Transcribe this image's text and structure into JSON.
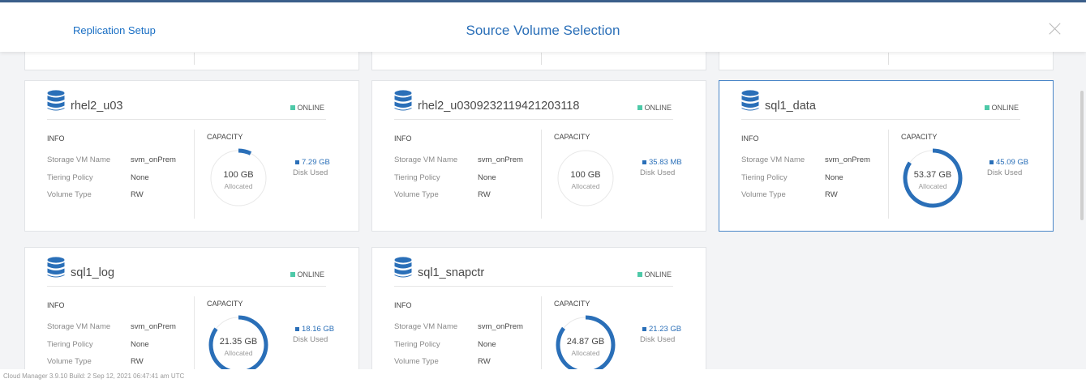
{
  "header": {
    "breadcrumb": "Replication Setup",
    "title": "Source Volume Selection"
  },
  "labels": {
    "info": "INFO",
    "capacity": "CAPACITY",
    "storage_vm": "Storage VM Name",
    "tiering": "Tiering Policy",
    "volume_type": "Volume Type",
    "allocated": "Allocated",
    "disk_used": "Disk Used"
  },
  "colors": {
    "accent": "#2a6fb8",
    "online": "#4ec9a8",
    "selected_border": "#4a86c8"
  },
  "volumes": [
    {
      "name": "rhel2_u03",
      "status": "ONLINE",
      "storage_vm": "svm_onPrem",
      "tiering": "None",
      "volume_type": "RW",
      "allocated": "100 GB",
      "disk_used": "7.29 GB",
      "used_fraction": 0.073,
      "selected": false,
      "icon": "database-icon"
    },
    {
      "name": "rhel2_u0309232119421203118",
      "status": "ONLINE",
      "storage_vm": "svm_onPrem",
      "tiering": "None",
      "volume_type": "RW",
      "allocated": "100 GB",
      "disk_used": "35.83 MB",
      "used_fraction": 0.0004,
      "selected": false,
      "icon": "database-icon"
    },
    {
      "name": "sql1_data",
      "status": "ONLINE",
      "storage_vm": "svm_onPrem",
      "tiering": "None",
      "volume_type": "RW",
      "allocated": "53.37 GB",
      "disk_used": "45.09 GB",
      "used_fraction": 0.845,
      "selected": true,
      "icon": "database-icon"
    },
    {
      "name": "sql1_log",
      "status": "ONLINE",
      "storage_vm": "svm_onPrem",
      "tiering": "None",
      "volume_type": "RW",
      "allocated": "21.35 GB",
      "disk_used": "18.16 GB",
      "used_fraction": 0.85,
      "selected": false,
      "icon": "database-icon"
    },
    {
      "name": "sql1_snapctr",
      "status": "ONLINE",
      "storage_vm": "svm_onPrem",
      "tiering": "None",
      "volume_type": "RW",
      "allocated": "24.87 GB",
      "disk_used": "21.23 GB",
      "used_fraction": 0.854,
      "selected": false,
      "icon": "database-icon"
    }
  ],
  "footer": {
    "text": "Cloud Manager 3.9.10   Build: 2   Sep 12, 2021 06:47:41 am UTC"
  }
}
